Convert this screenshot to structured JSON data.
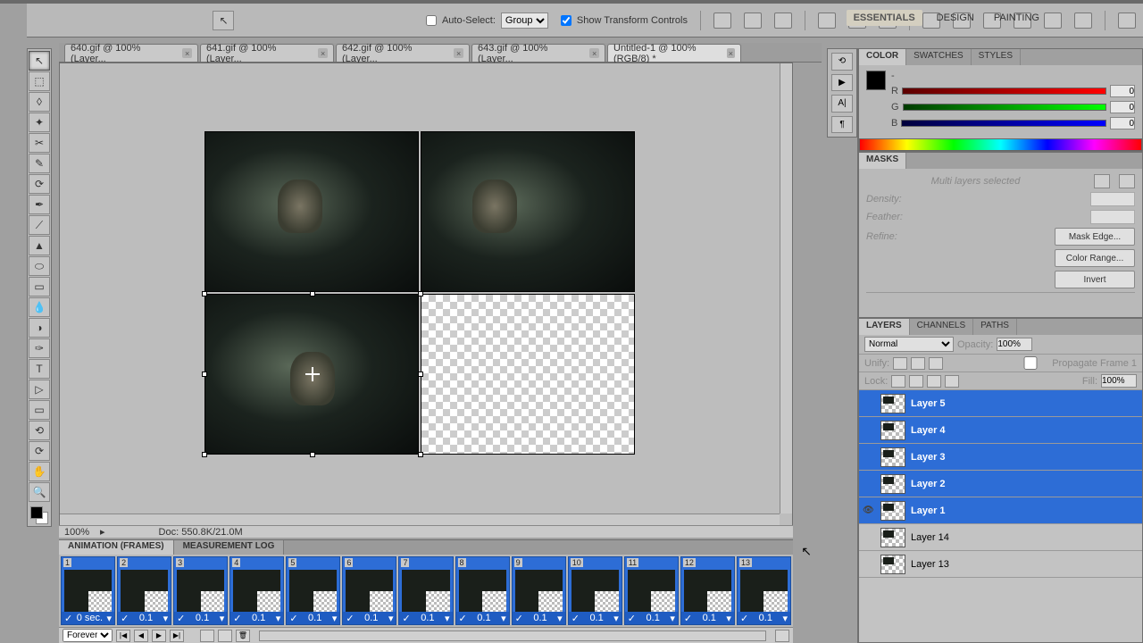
{
  "options": {
    "auto_select_label": "Auto-Select:",
    "auto_select_mode": "Group",
    "show_transform_label": "Show Transform Controls",
    "show_transform_checked": true,
    "auto_select_checked": false
  },
  "workspaces": {
    "active": "ESSENTIALS",
    "others": [
      "DESIGN",
      "PAINTING"
    ]
  },
  "doc_tabs": [
    {
      "label": "640.gif @ 100% (Layer...",
      "active": false
    },
    {
      "label": "641.gif @ 100% (Layer...",
      "active": false
    },
    {
      "label": "642.gif @ 100% (Layer...",
      "active": false
    },
    {
      "label": "643.gif @ 100% (Layer...",
      "active": false
    },
    {
      "label": "Untitled-1 @ 100% (RGB/8) *",
      "active": true
    }
  ],
  "status": {
    "zoom": "100%",
    "doc": "Doc: 550.8K/21.0M"
  },
  "panels": {
    "color": {
      "tabs": [
        "COLOR",
        "SWATCHES",
        "STYLES"
      ],
      "r": "0",
      "g": "0",
      "b": "0"
    },
    "masks": {
      "tab": "MASKS",
      "status": "Multi layers selected",
      "density": "Density:",
      "feather": "Feather:",
      "refine": "Refine:",
      "buttons": [
        "Mask Edge...",
        "Color Range...",
        "Invert"
      ]
    },
    "layers": {
      "tabs": [
        "LAYERS",
        "CHANNELS",
        "PATHS"
      ],
      "blend": "Normal",
      "opacity_label": "Opacity:",
      "opacity": "100%",
      "fill_label": "Fill:",
      "fill": "100%",
      "lock_label": "Lock:",
      "unify_label": "Unify:",
      "propagate_label": "Propagate Frame 1",
      "items": [
        {
          "name": "Layer 5",
          "selected": true,
          "visible": false
        },
        {
          "name": "Layer 4",
          "selected": true,
          "visible": false
        },
        {
          "name": "Layer 3",
          "selected": true,
          "visible": false
        },
        {
          "name": "Layer 2",
          "selected": true,
          "visible": false
        },
        {
          "name": "Layer 1",
          "selected": true,
          "visible": true
        },
        {
          "name": "Layer 14",
          "selected": false,
          "visible": false
        },
        {
          "name": "Layer 13",
          "selected": false,
          "visible": false
        }
      ]
    }
  },
  "timeline": {
    "tabs": [
      "ANIMATION (FRAMES)",
      "MEASUREMENT LOG"
    ],
    "loop": "Forever",
    "frames": [
      {
        "n": "1",
        "delay": "0 sec."
      },
      {
        "n": "2",
        "delay": "0.1"
      },
      {
        "n": "3",
        "delay": "0.1"
      },
      {
        "n": "4",
        "delay": "0.1"
      },
      {
        "n": "5",
        "delay": "0.1"
      },
      {
        "n": "6",
        "delay": "0.1"
      },
      {
        "n": "7",
        "delay": "0.1"
      },
      {
        "n": "8",
        "delay": "0.1"
      },
      {
        "n": "9",
        "delay": "0.1"
      },
      {
        "n": "10",
        "delay": "0.1"
      },
      {
        "n": "11",
        "delay": "0.1"
      },
      {
        "n": "12",
        "delay": "0.1"
      },
      {
        "n": "13",
        "delay": "0.1"
      }
    ]
  },
  "tools": [
    "↖",
    "⬚",
    "◊",
    "✦",
    "✂",
    "✎",
    "⟳",
    "✒",
    "⟋",
    "▲",
    "⬭",
    "T",
    "▱",
    "◐",
    "Q",
    "⊕",
    "✋",
    "🔍"
  ]
}
